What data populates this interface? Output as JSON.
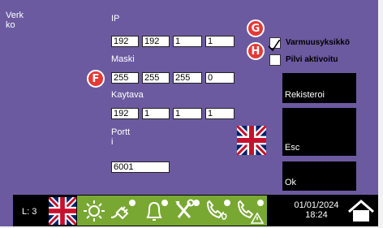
{
  "header": {
    "title_line1": "Verk",
    "title_line2": "ko"
  },
  "network": {
    "ip_label": "IP",
    "ip": [
      "192",
      "192",
      "1",
      "1"
    ],
    "mask_label": "Maski",
    "mask": [
      "255",
      "255",
      "255",
      "0"
    ],
    "gateway_label": "Kaytava",
    "gateway": [
      "192",
      "1",
      "1",
      "1"
    ],
    "port_label_line1": "Portt",
    "port_label_line2": "i",
    "port": "6001"
  },
  "options": {
    "secure_label": "Varmuusyksikkö",
    "secure_checked": true,
    "cloud_label": "Pilvi aktivoitu",
    "cloud_checked": false
  },
  "markers": {
    "g": "G",
    "h": "H",
    "f": "F"
  },
  "buttons": {
    "register": "Rekisteroi",
    "esc": "Esc",
    "ok": "Ok"
  },
  "status_bar": {
    "level": "L: 3",
    "date": "01/01/2024",
    "time": "18:24",
    "icons": [
      "uk-flag-icon",
      "sun-icon",
      "plug-icon",
      "bell-icon",
      "tools-icon",
      "phone-fire-icon",
      "phone-alert-icon",
      "home-icon"
    ]
  },
  "colors": {
    "background": "#6b5aa0",
    "status_green": "#78a832",
    "marker_red": "#e53935"
  }
}
